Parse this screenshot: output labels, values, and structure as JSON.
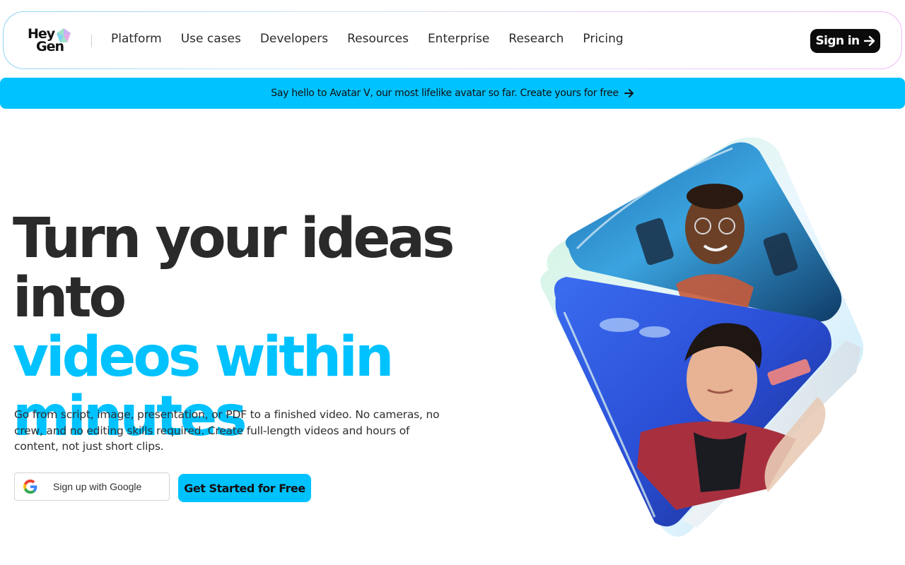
{
  "brand": {
    "logo_line1": "Hey",
    "logo_line2": "Gen",
    "accent": "#00c2ff"
  },
  "nav": {
    "links": [
      "Platform",
      "Use cases",
      "Developers",
      "Resources",
      "Enterprise",
      "Research",
      "Pricing"
    ],
    "signin_label": "Sign in"
  },
  "banner": {
    "text": "Say hello to Avatar V, our most lifelike avatar so far. Create yours for free"
  },
  "hero": {
    "title_line1": "Turn your ideas into",
    "title_line2": "videos within",
    "title_line3": "minutes",
    "subtitle": "Go from script, image, presentation, or PDF to a finished video. No cameras, no crew, and no editing skills required. Create full-length videos and hours of content, not just short clips.",
    "google_label": "Sign up with Google",
    "cta_label": "Get Started for Free"
  },
  "icons": [
    "heygen-logo-icon",
    "arrow-right-icon",
    "google-icon"
  ]
}
